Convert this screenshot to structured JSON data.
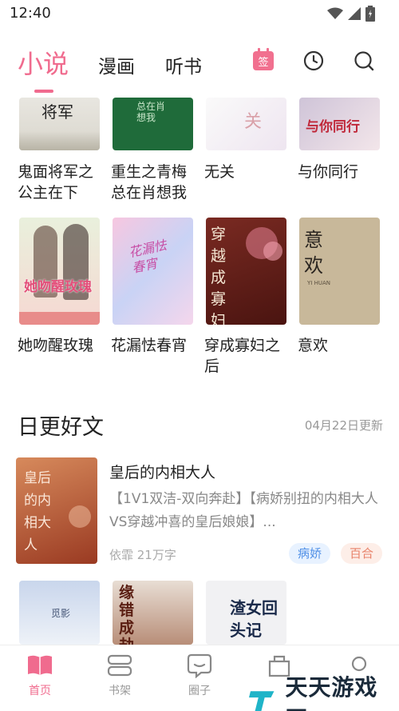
{
  "status": {
    "time": "12:40"
  },
  "tabs": [
    {
      "label": "小说",
      "active": true
    },
    {
      "label": "漫画",
      "active": false
    },
    {
      "label": "听书",
      "active": false
    }
  ],
  "header_icons": {
    "sign_label": "签",
    "history": "clock-icon",
    "search": "search-icon"
  },
  "books_row1": [
    {
      "title": "鬼面将军之公主在下",
      "cover_text": "将军"
    },
    {
      "title": "重生之青梅总在肖想我",
      "cover_text": "总在肖想我"
    },
    {
      "title": "无关",
      "cover_text": "关"
    },
    {
      "title": "与你同行",
      "cover_text": "与你同行"
    }
  ],
  "books_row2": [
    {
      "title": "她吻醒玫瑰",
      "cover_text": "她吻醒玫瑰"
    },
    {
      "title": "花漏怯春宵",
      "cover_text": "花漏怯春宵"
    },
    {
      "title": "穿成寡妇之后",
      "cover_text": "穿越成寡妇之后"
    },
    {
      "title": "意欢",
      "cover_text": "意欢",
      "cover_sub": "YI HUAN"
    }
  ],
  "section": {
    "title": "日更好文",
    "meta": "04月22日更新"
  },
  "featured": {
    "title": "皇后的内相大人",
    "description": "【1V1双洁-双向奔赴】【病娇别扭的内相大人VS穿越冲喜的皇后娘娘】...",
    "meta": "依霏 21万字",
    "tags": [
      "病娇",
      "百合"
    ],
    "cover_text": "皇后的内相大人"
  },
  "books_row3": [
    {
      "cover_text": "觅影"
    },
    {
      "cover_text": "缘错成劫"
    },
    {
      "cover_text": "渣女回头记"
    }
  ],
  "bottom_nav": [
    {
      "label": "首页",
      "active": true
    },
    {
      "label": "书架",
      "active": false
    },
    {
      "label": "圈子",
      "active": false
    }
  ],
  "watermark": {
    "text": "天天游戏网"
  },
  "colors": {
    "accent": "#f06b8e"
  }
}
